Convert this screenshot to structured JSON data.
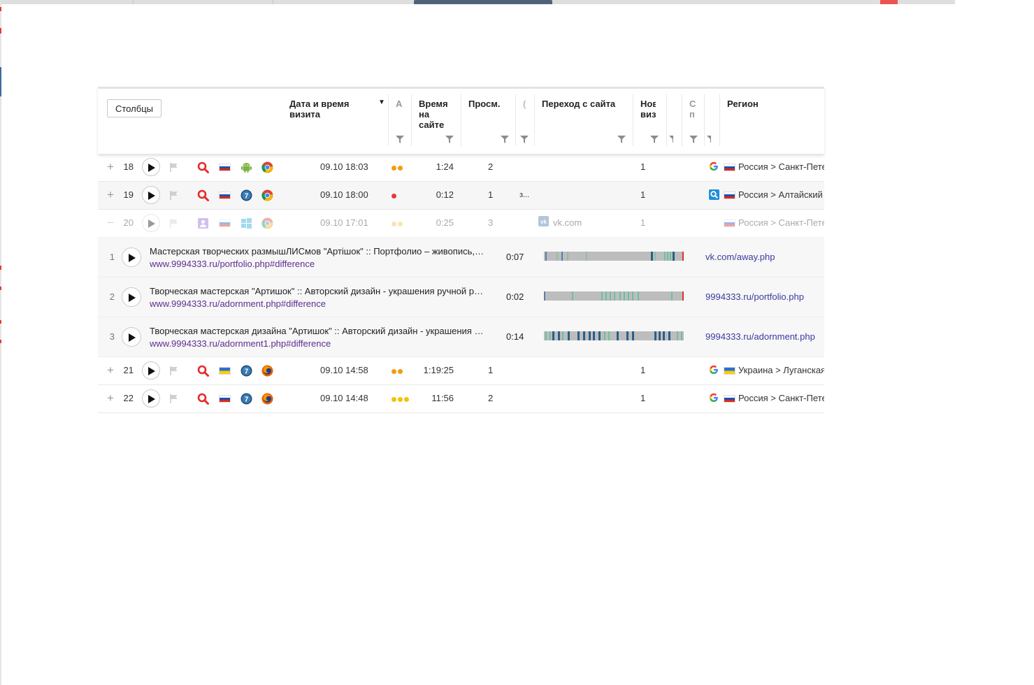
{
  "header": {
    "columns_button": "Столбцы",
    "date_time": "Дата и время визита",
    "date_time_short_a": "А",
    "time_on_site": "Время на сайте",
    "views": "Просм.",
    "narrow_col": "(",
    "referrer": "Переход с сайта",
    "new_visit": "Нов виз",
    "narrow_col2": "С п",
    "region": "Регион"
  },
  "rows": [
    {
      "num": "18",
      "expand": "+",
      "datetime": "09.10 18:03",
      "duration": "1:24",
      "views": "2",
      "extra": "",
      "referrer": "",
      "new_visit": "1",
      "region": "Россия > Санкт-Петербург",
      "os": "android-icon",
      "browser": "chrome-icon",
      "country": "russia-flag",
      "source": "google-icon",
      "dots": [
        "#f39c12",
        "#f39c12"
      ]
    },
    {
      "num": "19",
      "expand": "+",
      "datetime": "09.10 18:00",
      "duration": "0:12",
      "views": "1",
      "extra": "з...",
      "referrer": "",
      "new_visit": "1",
      "region": "Россия > Алтайский край",
      "os": "windows7-icon",
      "browser": "chrome-icon",
      "country": "russia-flag",
      "source": "yandex-search-icon",
      "dots": [
        "#e53935"
      ]
    },
    {
      "num": "20",
      "expand": "−",
      "datetime": "09.10 17:01",
      "duration": "0:25",
      "views": "3",
      "extra": "",
      "referrer": "vk.com",
      "new_visit": "1",
      "region": "Россия > Санкт-Петербург",
      "os": "windows-icon",
      "browser": "chrome-icon",
      "country": "russia-flag",
      "source": "",
      "dots": [
        "#f5c342",
        "#f5c342"
      ]
    }
  ],
  "subrows": [
    {
      "num": "1",
      "title": "Мастерская творческих размышЛИСмов \"Артiшок\" :: Портфолио – живопись, графика",
      "url": "www.9994333.ru/portfolio.php#difference",
      "time": "0:07",
      "referrer": "vk.com/away.php"
    },
    {
      "num": "2",
      "title": "Творческая мастерская \"Артишок\" :: Авторский дизайн - украшения ручной работы",
      "url": "www.9994333.ru/adornment.php#difference",
      "time": "0:02",
      "referrer": "9994333.ru/portfolio.php"
    },
    {
      "num": "3",
      "title": "Творческая мастерская дизайна \"Артишок\" :: Авторский дизайн - украшения ручной работы",
      "url": "www.9994333.ru/adornment1.php#difference",
      "time": "0:14",
      "referrer": "9994333.ru/adornment.php"
    }
  ],
  "rows2": [
    {
      "num": "21",
      "expand": "+",
      "datetime": "09.10 14:58",
      "duration": "1:19:25",
      "views": "1",
      "extra": "",
      "referrer": "",
      "new_visit": "1",
      "region": "Украина > Луганская область",
      "os": "windows7-icon",
      "browser": "firefox-icon",
      "country": "ukraine-flag",
      "source": "google-icon",
      "dots": [
        "#f39c12",
        "#f39c12"
      ]
    },
    {
      "num": "22",
      "expand": "+",
      "datetime": "09.10 14:48",
      "duration": "11:56",
      "views": "2",
      "extra": "",
      "referrer": "",
      "new_visit": "1",
      "region": "Россия > Санкт-Петербург",
      "os": "windows7-icon",
      "browser": "firefox-icon",
      "country": "russia-flag",
      "source": "google-icon",
      "dots": [
        "#f5c20a",
        "#f5c20a",
        "#f5c20a"
      ]
    }
  ]
}
